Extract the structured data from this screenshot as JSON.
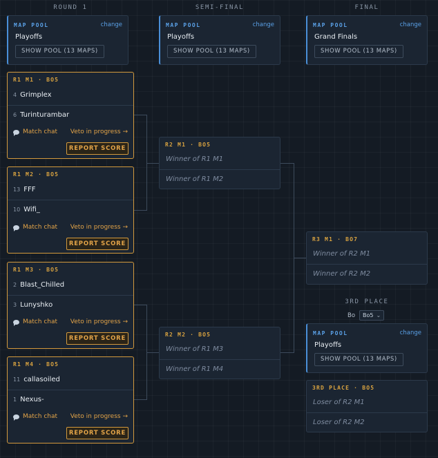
{
  "columns": [
    "ROUND 1",
    "SEMI-FINAL",
    "FINAL"
  ],
  "pools": [
    {
      "tag": "MAP POOL",
      "change": "change",
      "name": "Playoffs",
      "button": "SHOW POOL (13 MAPS)"
    },
    {
      "tag": "MAP POOL",
      "change": "change",
      "name": "Playoffs",
      "button": "SHOW POOL (13 MAPS)"
    },
    {
      "tag": "MAP POOL",
      "change": "change",
      "name": "Grand Finals",
      "button": "SHOW POOL (13 MAPS)"
    },
    {
      "tag": "MAP POOL",
      "change": "change",
      "name": "Playoffs",
      "button": "SHOW POOL (13 MAPS)"
    }
  ],
  "round1": [
    {
      "tag": "R1 M1 · BO5",
      "p1": {
        "seed": "4",
        "name": "Grimplex"
      },
      "p2": {
        "seed": "6",
        "name": "Turinturambar"
      },
      "chat": "Match chat",
      "veto": "Veto in progress →",
      "report": "REPORT SCORE"
    },
    {
      "tag": "R1 M2 · BO5",
      "p1": {
        "seed": "13",
        "name": "FFF"
      },
      "p2": {
        "seed": "10",
        "name": "Wifi_"
      },
      "chat": "Match chat",
      "veto": "Veto in progress →",
      "report": "REPORT SCORE"
    },
    {
      "tag": "R1 M3 · BO5",
      "p1": {
        "seed": "2",
        "name": "Blast_Chilled"
      },
      "p2": {
        "seed": "3",
        "name": "Lunyshko"
      },
      "chat": "Match chat",
      "veto": "Veto in progress →",
      "report": "REPORT SCORE"
    },
    {
      "tag": "R1 M4 · BO5",
      "p1": {
        "seed": "11",
        "name": "callasoiled"
      },
      "p2": {
        "seed": "1",
        "name": "Nexus-"
      },
      "chat": "Match chat",
      "veto": "Veto in progress →",
      "report": "REPORT SCORE"
    }
  ],
  "semis": [
    {
      "tag": "R2 M1 · BO5",
      "p1": "Winner of R1 M1",
      "p2": "Winner of R1 M2"
    },
    {
      "tag": "R2 M2 · BO5",
      "p1": "Winner of R1 M3",
      "p2": "Winner of R1 M4"
    }
  ],
  "final": {
    "tag": "R3 M1 · BO7",
    "p1": "Winner of R2 M1",
    "p2": "Winner of R2 M2"
  },
  "third_place": {
    "title": "3RD PLACE",
    "bo_label": "Bo",
    "bo_value": "Bo5",
    "match": {
      "tag": "3RD PLACE · BO5",
      "p1": "Loser of R2 M1",
      "p2": "Loser of R2 M2"
    }
  }
}
